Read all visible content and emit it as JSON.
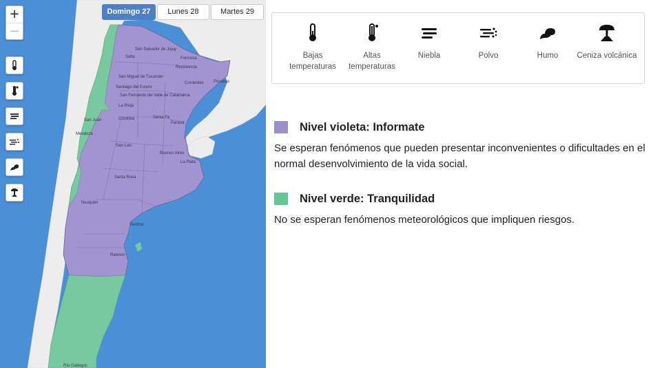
{
  "map": {
    "zoom_in_label": "+",
    "zoom_out_label": "−",
    "layer_buttons": [
      {
        "name": "bajas-temperaturas",
        "icon": "thermometer-low-icon"
      },
      {
        "name": "altas-temperaturas",
        "icon": "thermometer-high-icon"
      },
      {
        "name": "niebla",
        "icon": "fog-icon"
      },
      {
        "name": "polvo",
        "icon": "dust-icon"
      },
      {
        "name": "humo",
        "icon": "smoke-icon"
      },
      {
        "name": "ceniza",
        "icon": "volcanic-ash-icon"
      }
    ],
    "day_tabs": [
      {
        "label": "Domingo 27",
        "active": true
      },
      {
        "label": "Lunes 28",
        "active": false
      },
      {
        "label": "Martes 29",
        "active": false
      }
    ],
    "place_labels": [
      "San Salvador de Jujuy",
      "Salta",
      "San Miguel de Tucumán",
      "Resistencia",
      "Formosa",
      "Posadas",
      "Corrientes",
      "Santiago del Estero",
      "San Fernando del Valle de Catamarca",
      "La Rioja",
      "Córdoba",
      "Santa Fe",
      "Paraná",
      "San Juan",
      "Mendoza",
      "San Luis",
      "Buenos Aires",
      "La Plata",
      "Santa Rosa",
      "Neuquén",
      "Viedma",
      "Rawson",
      "Río Gallegos"
    ],
    "colors": {
      "sea": "#4a90d9",
      "neighbor_land": "#ededed",
      "violet": "#a294d0",
      "green": "#79c9a0",
      "border": "#6e6290"
    }
  },
  "phenomena": [
    {
      "label": "Bajas temperaturas",
      "icon": "thermometer-low-icon"
    },
    {
      "label": "Altas temperaturas",
      "icon": "thermometer-high-icon"
    },
    {
      "label": "Niebla",
      "icon": "fog-icon"
    },
    {
      "label": "Polvo",
      "icon": "dust-icon"
    },
    {
      "label": "Humo",
      "icon": "smoke-icon"
    },
    {
      "label": "Ceniza volcánica",
      "icon": "volcanic-ash-icon"
    }
  ],
  "levels": [
    {
      "title": "Nivel violeta: Informate",
      "color": "#9b8fcc",
      "description": "Se esperan fenómenos que pueden presentar inconvenientes o dificultades en el normal desenvolvimiento de la vida social."
    },
    {
      "title": "Nivel verde: Tranquilidad",
      "color": "#66c795",
      "description": "No se esperan fenómenos meteorológicos que impliquen riesgos."
    }
  ]
}
